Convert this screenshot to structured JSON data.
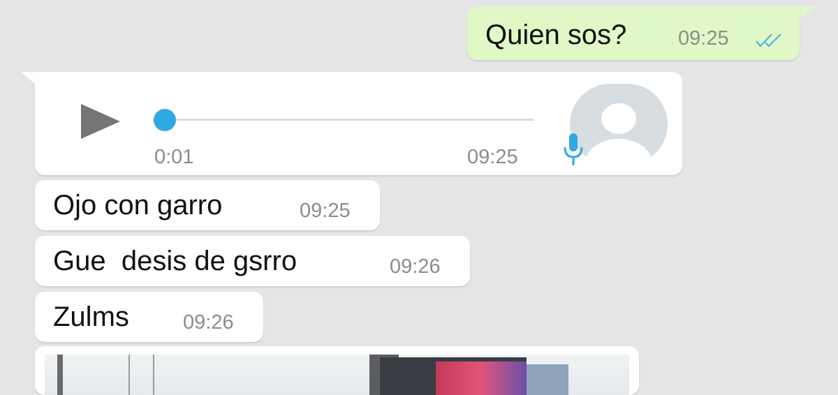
{
  "messages": {
    "outgoing": {
      "text": "Quien sos?",
      "time": "09:25",
      "status_icon": "double-check-icon"
    },
    "voice": {
      "duration": "0:01",
      "time": "09:25",
      "icons": [
        "play-icon",
        "avatar-icon",
        "microphone-icon"
      ]
    },
    "incoming": [
      {
        "text": "Ojo con garro",
        "time": "09:25"
      },
      {
        "text": "Gue  desis de gsrro",
        "time": "09:26"
      },
      {
        "text": "Zulms",
        "time": "09:26"
      }
    ],
    "image_message": {
      "icon": "photo-thumbnail"
    }
  },
  "colors": {
    "background": "#e5e5e5",
    "outgoing_bubble": "#e0f8c6",
    "incoming_bubble": "#ffffff",
    "accent_blue": "#2fa8e4",
    "timestamp": "#8c8c8c"
  }
}
